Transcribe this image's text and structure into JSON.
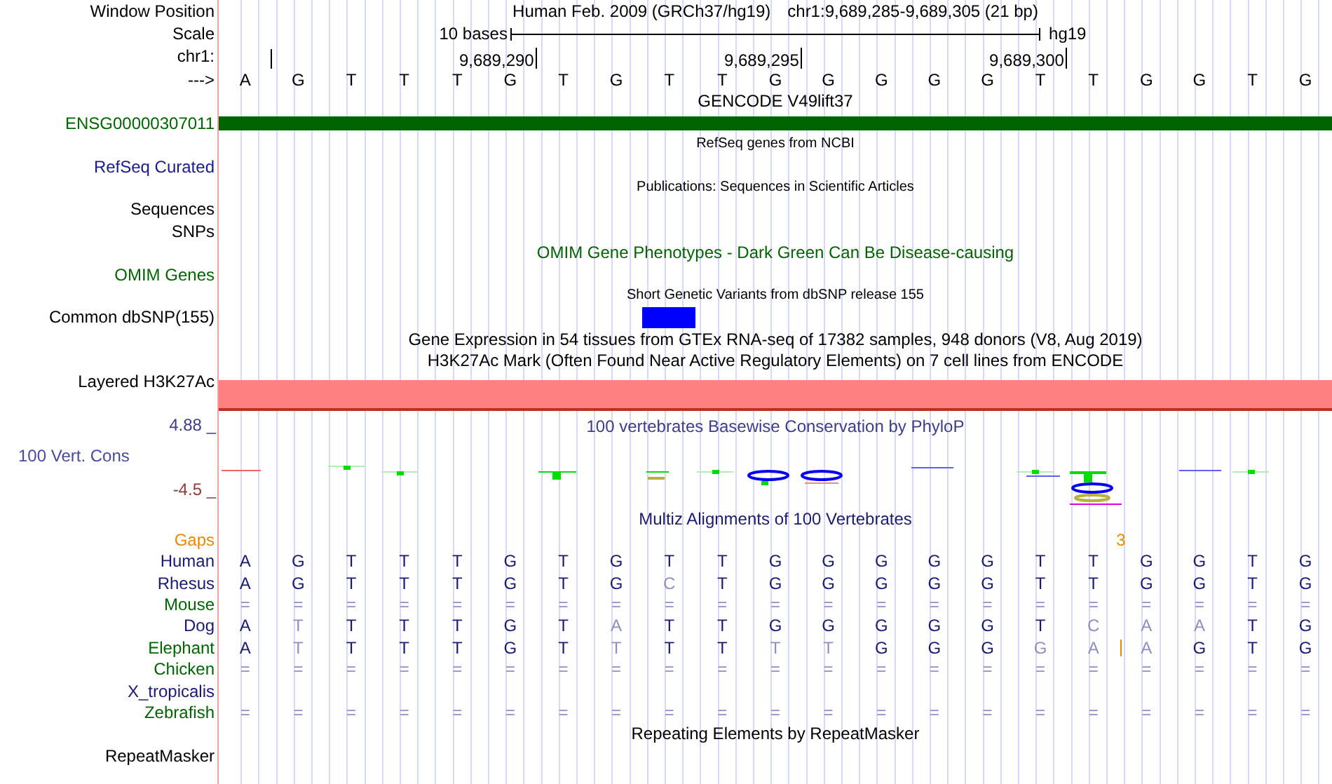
{
  "header": {
    "window_position": {
      "label": "Window Position",
      "assembly": "Human Feb. 2009 (GRCh37/hg19)",
      "range": "chr1:9,689,285-9,689,305 (21 bp)"
    },
    "scale": {
      "label": "Scale",
      "span": "10 bases",
      "build": "hg19"
    },
    "coordinates": {
      "label": "chr1:",
      "ticks": [
        "9,689,290",
        "9,689,295",
        "9,689,300"
      ]
    },
    "sequence": {
      "label": "--->",
      "bases": [
        {
          "base": "A",
          "common_snp": false
        },
        {
          "base": "G",
          "common_snp": false
        },
        {
          "base": "T",
          "common_snp": false
        },
        {
          "base": "T",
          "common_snp": false
        },
        {
          "base": "T",
          "common_snp": false
        },
        {
          "base": "G",
          "common_snp": false
        },
        {
          "base": "T",
          "common_snp": false
        },
        {
          "base": "G",
          "common_snp": false
        },
        {
          "base": "T",
          "common_snp": true
        },
        {
          "base": "T",
          "common_snp": false
        },
        {
          "base": "G",
          "common_snp": false
        },
        {
          "base": "G",
          "common_snp": false
        },
        {
          "base": "G",
          "common_snp": false
        },
        {
          "base": "G",
          "common_snp": false
        },
        {
          "base": "G",
          "common_snp": false
        },
        {
          "base": "T",
          "common_snp": false
        },
        {
          "base": "T",
          "common_snp": false
        },
        {
          "base": "G",
          "common_snp": false
        },
        {
          "base": "G",
          "common_snp": false
        },
        {
          "base": "T",
          "common_snp": false
        },
        {
          "base": "G",
          "common_snp": false
        }
      ]
    }
  },
  "tracks": [
    {
      "kind": "title",
      "text": "GENCODE V49lift37",
      "color": "#000000"
    },
    {
      "kind": "gene_bar",
      "label": "ENSG00000307011",
      "color": "#006400"
    },
    {
      "kind": "note",
      "text": "RefSeq genes from NCBI"
    },
    {
      "kind": "label",
      "label": "RefSeq Curated",
      "color": "#1a1a8c"
    },
    {
      "kind": "note",
      "text": "Publications: Sequences in Scientific Articles"
    },
    {
      "kind": "label",
      "label": "Sequences",
      "color": "#000000"
    },
    {
      "kind": "label",
      "label": "SNPs",
      "color": "#000000"
    },
    {
      "kind": "title",
      "text": "OMIM Gene Phenotypes - Dark Green Can Be Disease-causing",
      "color": "#006400"
    },
    {
      "kind": "label",
      "label": "OMIM Genes",
      "color": "#006400"
    },
    {
      "kind": "note",
      "text": "Short Genetic Variants from dbSNP release 155"
    },
    {
      "kind": "snp",
      "label": "Common dbSNP(155)",
      "color": "#000000"
    },
    {
      "kind": "title",
      "text": "Gene Expression in 54 tissues from GTEx RNA-seq of 17382 samples, 948 donors (V8, Aug 2019)",
      "color": "#000000"
    },
    {
      "kind": "title",
      "text": "H3K27Ac Mark (Often Found Near Active Regulatory Elements) on 7 cell lines from ENCODE",
      "color": "#000000"
    },
    {
      "kind": "signal_bar",
      "label": "Layered H3K27Ac",
      "color": "#000000"
    },
    {
      "kind": "conservation",
      "title": "100 vertebrates Basewise Conservation by PhyloP",
      "label": "100 Vert. Cons",
      "max": "4.88 _",
      "min": "-4.5 _"
    },
    {
      "kind": "title",
      "text": "Multiz Alignments of 100 Vertebrates",
      "color": "#1a1a6e"
    },
    {
      "kind": "gaps",
      "label": "Gaps",
      "color": "#e68a00",
      "insertions": [
        "3"
      ]
    },
    {
      "kind": "species",
      "label": "Human",
      "color": "#1a1a6e",
      "bases": [
        {
          "base": "A",
          "matches": true
        },
        {
          "base": "G",
          "matches": true
        },
        {
          "base": "T",
          "matches": true
        },
        {
          "base": "T",
          "matches": true
        },
        {
          "base": "T",
          "matches": true
        },
        {
          "base": "G",
          "matches": true
        },
        {
          "base": "T",
          "matches": true
        },
        {
          "base": "G",
          "matches": true
        },
        {
          "base": "T",
          "matches": true
        },
        {
          "base": "T",
          "matches": true
        },
        {
          "base": "G",
          "matches": true
        },
        {
          "base": "G",
          "matches": true
        },
        {
          "base": "G",
          "matches": true
        },
        {
          "base": "G",
          "matches": true
        },
        {
          "base": "G",
          "matches": true
        },
        {
          "base": "T",
          "matches": true
        },
        {
          "base": "T",
          "matches": true
        },
        {
          "base": "G",
          "matches": true
        },
        {
          "base": "G",
          "matches": true
        },
        {
          "base": "T",
          "matches": true
        },
        {
          "base": "G",
          "matches": true
        }
      ]
    },
    {
      "kind": "species",
      "label": "Rhesus",
      "color": "#1a1a6e",
      "bases": [
        {
          "base": "A",
          "matches": true
        },
        {
          "base": "G",
          "matches": true
        },
        {
          "base": "T",
          "matches": true
        },
        {
          "base": "T",
          "matches": true
        },
        {
          "base": "T",
          "matches": true
        },
        {
          "base": "G",
          "matches": true
        },
        {
          "base": "T",
          "matches": true
        },
        {
          "base": "G",
          "matches": true
        },
        {
          "base": "C",
          "matches": false
        },
        {
          "base": "T",
          "matches": true
        },
        {
          "base": "G",
          "matches": true
        },
        {
          "base": "G",
          "matches": true
        },
        {
          "base": "G",
          "matches": true
        },
        {
          "base": "G",
          "matches": true
        },
        {
          "base": "G",
          "matches": true
        },
        {
          "base": "T",
          "matches": true
        },
        {
          "base": "T",
          "matches": true
        },
        {
          "base": "G",
          "matches": true
        },
        {
          "base": "G",
          "matches": true
        },
        {
          "base": "T",
          "matches": true
        },
        {
          "base": "G",
          "matches": true
        }
      ]
    },
    {
      "kind": "species",
      "label": "Mouse",
      "color": "#006400",
      "bases": [
        {
          "base": "=",
          "matches": false
        },
        {
          "base": "=",
          "matches": false
        },
        {
          "base": "=",
          "matches": false
        },
        {
          "base": "=",
          "matches": false
        },
        {
          "base": "=",
          "matches": false
        },
        {
          "base": "=",
          "matches": false
        },
        {
          "base": "=",
          "matches": false
        },
        {
          "base": "=",
          "matches": false
        },
        {
          "base": "=",
          "matches": false
        },
        {
          "base": "=",
          "matches": false
        },
        {
          "base": "=",
          "matches": false
        },
        {
          "base": "=",
          "matches": false
        },
        {
          "base": "=",
          "matches": false
        },
        {
          "base": "=",
          "matches": false
        },
        {
          "base": "=",
          "matches": false
        },
        {
          "base": "=",
          "matches": false
        },
        {
          "base": "=",
          "matches": false
        },
        {
          "base": "=",
          "matches": false
        },
        {
          "base": "=",
          "matches": false
        },
        {
          "base": "=",
          "matches": false
        },
        {
          "base": "=",
          "matches": false
        }
      ]
    },
    {
      "kind": "species",
      "label": "Dog",
      "color": "#1a1a6e",
      "bases": [
        {
          "base": "A",
          "matches": true
        },
        {
          "base": "T",
          "matches": false
        },
        {
          "base": "T",
          "matches": true
        },
        {
          "base": "T",
          "matches": true
        },
        {
          "base": "T",
          "matches": true
        },
        {
          "base": "G",
          "matches": true
        },
        {
          "base": "T",
          "matches": true
        },
        {
          "base": "A",
          "matches": false
        },
        {
          "base": "T",
          "matches": true
        },
        {
          "base": "T",
          "matches": true
        },
        {
          "base": "G",
          "matches": true
        },
        {
          "base": "G",
          "matches": true
        },
        {
          "base": "G",
          "matches": true
        },
        {
          "base": "G",
          "matches": true
        },
        {
          "base": "G",
          "matches": true
        },
        {
          "base": "T",
          "matches": true
        },
        {
          "base": "C",
          "matches": false
        },
        {
          "base": "A",
          "matches": false
        },
        {
          "base": "A",
          "matches": false
        },
        {
          "base": "T",
          "matches": true
        },
        {
          "base": "G",
          "matches": true
        }
      ]
    },
    {
      "kind": "species",
      "label": "Elephant",
      "color": "#006400",
      "bases": [
        {
          "base": "A",
          "matches": true,
          "insertion": false
        },
        {
          "base": "T",
          "matches": false,
          "insertion": false
        },
        {
          "base": "T",
          "matches": true,
          "insertion": false
        },
        {
          "base": "T",
          "matches": true,
          "insertion": false
        },
        {
          "base": "T",
          "matches": true,
          "insertion": false
        },
        {
          "base": "G",
          "matches": true,
          "insertion": false
        },
        {
          "base": "T",
          "matches": true,
          "insertion": false
        },
        {
          "base": "T",
          "matches": false,
          "insertion": false
        },
        {
          "base": "T",
          "matches": true,
          "insertion": false
        },
        {
          "base": "T",
          "matches": true,
          "insertion": false
        },
        {
          "base": "T",
          "matches": false,
          "insertion": false
        },
        {
          "base": "T",
          "matches": false,
          "insertion": false
        },
        {
          "base": "G",
          "matches": true,
          "insertion": false
        },
        {
          "base": "G",
          "matches": true,
          "insertion": false
        },
        {
          "base": "G",
          "matches": true,
          "insertion": false
        },
        {
          "base": "G",
          "matches": false,
          "insertion": false
        },
        {
          "base": "A",
          "matches": false,
          "insertion": true
        },
        {
          "base": "A",
          "matches": false,
          "insertion": false
        },
        {
          "base": "G",
          "matches": true,
          "insertion": false
        },
        {
          "base": "T",
          "matches": true,
          "insertion": false
        },
        {
          "base": "G",
          "matches": true,
          "insertion": false
        }
      ]
    },
    {
      "kind": "species",
      "label": "Chicken",
      "color": "#006400",
      "bases": [
        {
          "base": "=",
          "matches": false
        },
        {
          "base": "=",
          "matches": false
        },
        {
          "base": "=",
          "matches": false
        },
        {
          "base": "=",
          "matches": false
        },
        {
          "base": "=",
          "matches": false
        },
        {
          "base": "=",
          "matches": false
        },
        {
          "base": "=",
          "matches": false
        },
        {
          "base": "=",
          "matches": false
        },
        {
          "base": "=",
          "matches": false
        },
        {
          "base": "=",
          "matches": false
        },
        {
          "base": "=",
          "matches": false
        },
        {
          "base": "=",
          "matches": false
        },
        {
          "base": "=",
          "matches": false
        },
        {
          "base": "=",
          "matches": false
        },
        {
          "base": "=",
          "matches": false
        },
        {
          "base": "=",
          "matches": false
        },
        {
          "base": "=",
          "matches": false
        },
        {
          "base": "=",
          "matches": false
        },
        {
          "base": "=",
          "matches": false
        },
        {
          "base": "=",
          "matches": false
        },
        {
          "base": "=",
          "matches": false
        }
      ]
    },
    {
      "kind": "species",
      "label": "X_tropicalis",
      "color": "#1a1a6e"
    },
    {
      "kind": "species",
      "label": "Zebrafish",
      "color": "#006400",
      "bases": [
        {
          "base": "=",
          "matches": false
        },
        {
          "base": "=",
          "matches": false
        },
        {
          "base": "=",
          "matches": false
        },
        {
          "base": "=",
          "matches": false
        },
        {
          "base": "=",
          "matches": false
        },
        {
          "base": "=",
          "matches": false
        },
        {
          "base": "=",
          "matches": false
        },
        {
          "base": "=",
          "matches": false
        },
        {
          "base": "=",
          "matches": false
        },
        {
          "base": "=",
          "matches": false
        },
        {
          "base": "=",
          "matches": false
        },
        {
          "base": "=",
          "matches": false
        },
        {
          "base": "=",
          "matches": false
        },
        {
          "base": "=",
          "matches": false
        },
        {
          "base": "=",
          "matches": false
        },
        {
          "base": "=",
          "matches": false
        },
        {
          "base": "=",
          "matches": false
        },
        {
          "base": "=",
          "matches": false
        },
        {
          "base": "=",
          "matches": false
        },
        {
          "base": "=",
          "matches": false
        },
        {
          "base": "=",
          "matches": false
        }
      ]
    },
    {
      "kind": "title",
      "text": "Repeating Elements by RepeatMasker",
      "color": "#000000"
    },
    {
      "kind": "label",
      "label": "RepeatMasker",
      "color": "#000000"
    }
  ]
}
